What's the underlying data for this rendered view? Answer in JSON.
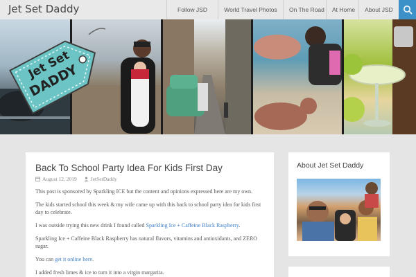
{
  "header": {
    "site_title": "Jet Set Daddy",
    "nav": [
      "Follow JSD",
      "World Travel Photos",
      "On The Road",
      "At Home",
      "About JSD"
    ],
    "search_icon": "search-icon",
    "search_color": "#3c91c8"
  },
  "logo": {
    "line1": "Jet Set",
    "line2": "DADDY",
    "tag_color": "#6cc4c4"
  },
  "article": {
    "title": "Back To School Party Idea For Kids First Day",
    "date": "August 12, 2019",
    "author": "JetSetDaddy",
    "p1": "This post is sponsored by Sparkling ICE but the content and opinions expressed here are my own.",
    "p2": "The kids started school this week & my wife came up with this back to school party idea for kids first day to celebrate.",
    "p3_prefix": "I was outside trying this new drink I found called ",
    "p3_link": "Sparkling Ice + Caffeine Black Raspberry",
    "p3_suffix": ".",
    "p4": "Sparkling Ice + Caffeine Black Raspberry has natural flavors, vitamins and antioxidants, and ZERO sugar.",
    "p5_prefix": "You can ",
    "p5_link": "get it online here",
    "p5_suffix": ".",
    "p6": "I added fresh limes & ice to turn it into a virgin margarita.",
    "link_color": "#3c7dc4"
  },
  "sidebar": {
    "widget_title": "About Jet Set Daddy"
  }
}
